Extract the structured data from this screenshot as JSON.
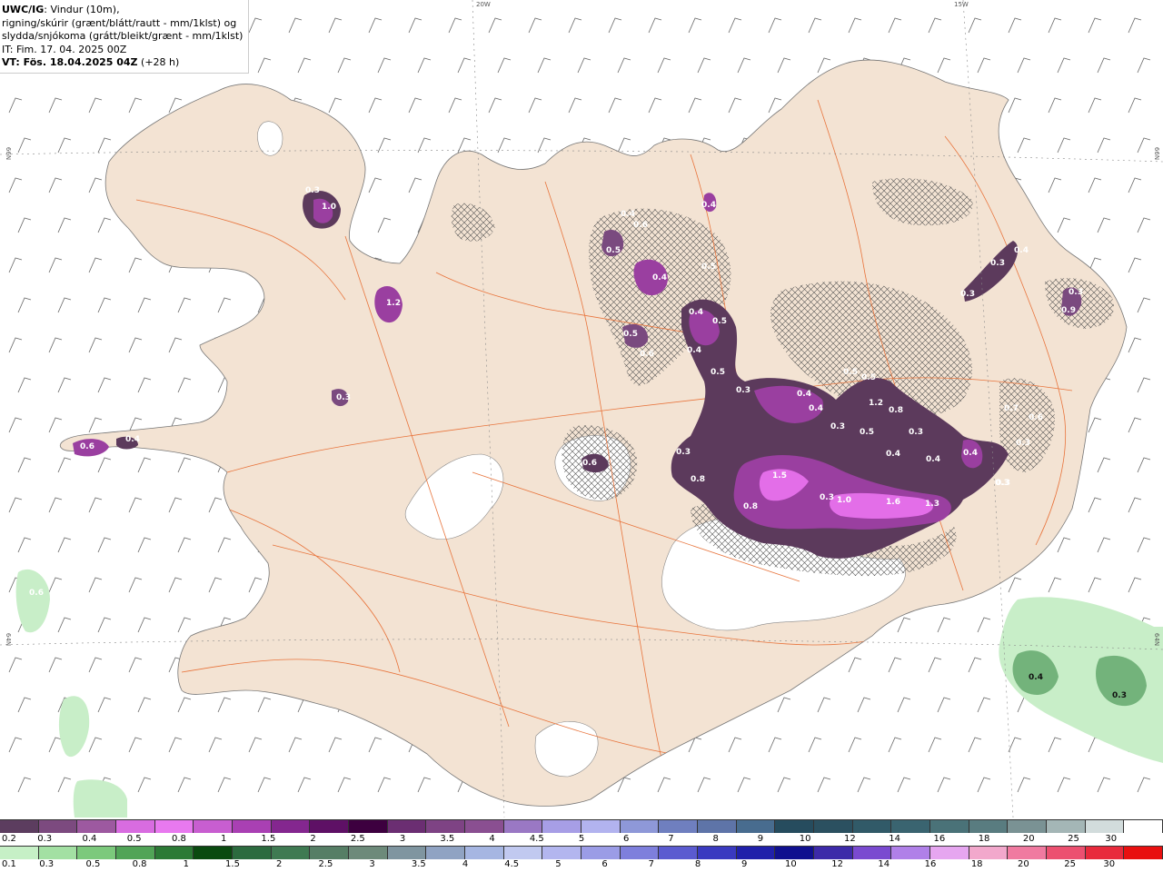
{
  "header": {
    "line1_bold": "UWC/IG",
    "line1_rest": ": Vindur (10m),",
    "line2": "rigning/skúrir (grænt/blátt/rautt - mm/1klst) og",
    "line3": "slydda/snjókoma (grátt/bleikt/grænt - mm/1klst)",
    "line4": "IT: Fim. 17. 04. 2025 00Z",
    "line5_bold": "VT: Fös. 18.04.2025 04Z",
    "line5_rest": " (+28 h)"
  },
  "coords": {
    "top_20w": "20W",
    "top_15w": "15W",
    "left_66n": "66N",
    "right_66n": "66N",
    "left_64n": "64N",
    "right_64n": "64N"
  },
  "colors": {
    "land": "#f3e3d3",
    "sea": "#ffffff",
    "roads": "#e8743c",
    "snow_light": "#5c3a5c",
    "snow_mid": "#9a3fa0",
    "snow_heavy": "#e36ee8",
    "rain_light": "#c8eec8",
    "rain_mid": "#4f9a5a"
  },
  "precip_labels": [
    {
      "text": "0.3"
    },
    {
      "text": "1.0"
    },
    {
      "text": "1.2"
    },
    {
      "text": "0.3"
    },
    {
      "text": "0.6"
    },
    {
      "text": "0.4"
    },
    {
      "text": "0.4"
    },
    {
      "text": "0.5"
    },
    {
      "text": "0.6"
    },
    {
      "text": "0.4"
    },
    {
      "text": "0.5"
    },
    {
      "text": "0.6"
    },
    {
      "text": "0.4"
    },
    {
      "text": "0.5"
    },
    {
      "text": "0.4"
    },
    {
      "text": "0.5"
    },
    {
      "text": "0.4"
    },
    {
      "text": "0.5"
    },
    {
      "text": "0.3"
    },
    {
      "text": "0.4"
    },
    {
      "text": "0.3"
    },
    {
      "text": "0.3"
    },
    {
      "text": "0.3"
    },
    {
      "text": "0.9"
    },
    {
      "text": "0.4"
    },
    {
      "text": "0.4"
    },
    {
      "text": "0.5"
    },
    {
      "text": "0.5"
    },
    {
      "text": "1.2"
    },
    {
      "text": "0.8"
    },
    {
      "text": "0.3"
    },
    {
      "text": "0.5"
    },
    {
      "text": "0.4"
    },
    {
      "text": "0.3"
    },
    {
      "text": "0.4"
    },
    {
      "text": "0.4"
    },
    {
      "text": "0.7"
    },
    {
      "text": "0.6"
    },
    {
      "text": "0.3"
    },
    {
      "text": "0.3"
    },
    {
      "text": "0.8"
    },
    {
      "text": "1.5"
    },
    {
      "text": "0.8"
    },
    {
      "text": "0.3"
    },
    {
      "text": "1.0"
    },
    {
      "text": "1.6"
    },
    {
      "text": "1.3"
    },
    {
      "text": "0.4"
    },
    {
      "text": "0.3"
    },
    {
      "text": "0.3"
    },
    {
      "text": "0.6"
    },
    {
      "text": "0.6"
    },
    {
      "text": "0.3"
    }
  ],
  "legend": {
    "snow_colors": [
      "#5c3d5f",
      "#7c4a7f",
      "#9d59a0",
      "#d86ce0",
      "#e879ef",
      "#c85ed0",
      "#a940b3",
      "#84278f",
      "#5e1065",
      "#3d003f",
      "#6b2e72",
      "#7e4384",
      "#8a4f91",
      "#9a78c4",
      "#a79ee6",
      "#b2b3ef",
      "#8e98d8",
      "#6f7fbf",
      "#5e74a8",
      "#486c8f",
      "#264c5e",
      "#2b5060",
      "#315a68",
      "#3a6470",
      "#4a7278",
      "#597c80",
      "#7a9294",
      "#a4b6b6",
      "#d2dcdc",
      "#ffffff"
    ],
    "snow_labels": [
      "0.2",
      "0.3",
      "0.4",
      "0.5",
      "0.8",
      "1",
      "1.5",
      "2",
      "2.5",
      "3",
      "3.5",
      "4",
      "4.5",
      "5",
      "6",
      "7",
      "8",
      "9",
      "10",
      "12",
      "14",
      "16",
      "18",
      "20",
      "25",
      "30"
    ],
    "rain_colors": [
      "#c6f0c6",
      "#a3e0a3",
      "#7cc97c",
      "#51a457",
      "#2c7a36",
      "#0a4a10",
      "#2c6b3f",
      "#3f7a52",
      "#567e65",
      "#6d8a7a",
      "#7f95a0",
      "#90a3c3",
      "#a6b6e2",
      "#c1c9f0",
      "#b3b6ef",
      "#9b9ce6",
      "#7e7fdc",
      "#5b5bd0",
      "#3a3ac0",
      "#2020aa",
      "#10108f",
      "#3d2aa9",
      "#7a4ad0",
      "#b080e8",
      "#e6a6f0",
      "#f2a8cc",
      "#f07aa0",
      "#ec5070",
      "#e82a3c",
      "#e81010"
    ],
    "rain_labels": [
      "0.1",
      "0.3",
      "0.5",
      "0.8",
      "1",
      "1.5",
      "2",
      "2.5",
      "3",
      "3.5",
      "4",
      "4.5",
      "5",
      "6",
      "7",
      "8",
      "9",
      "10",
      "12",
      "14",
      "16",
      "18",
      "20",
      "25",
      "30"
    ]
  }
}
